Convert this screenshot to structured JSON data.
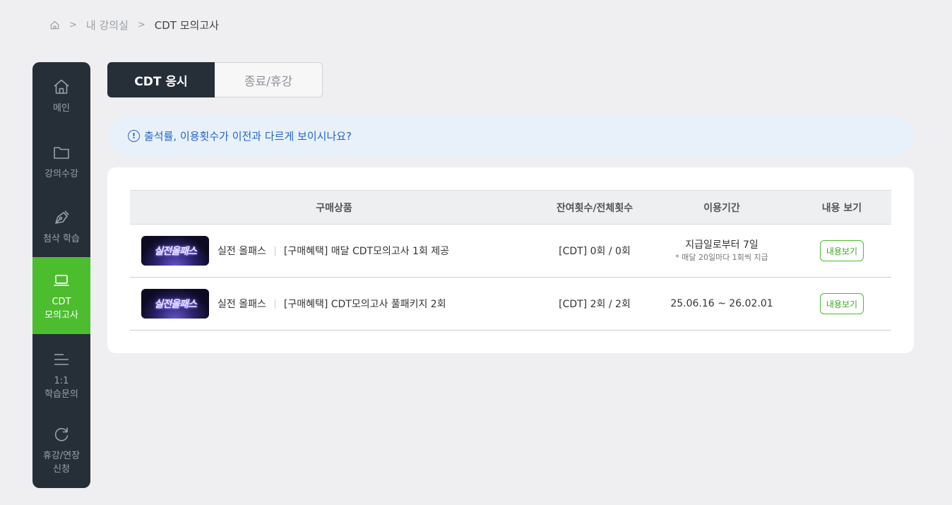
{
  "breadcrumb": {
    "home_icon": "home-icon",
    "items": [
      "내 강의실",
      "CDT 모의고사"
    ]
  },
  "sidebar": {
    "items": [
      {
        "label": "메인",
        "icon": "home-icon"
      },
      {
        "label": "강의수강",
        "icon": "folder-icon"
      },
      {
        "label": "첨삭 학습",
        "icon": "pen-nib-icon"
      },
      {
        "label": "CDT\n모의고사",
        "icon": "laptop-icon",
        "active": true
      },
      {
        "label": "1:1\n학습문의",
        "icon": "menu-lines-icon"
      },
      {
        "label": "휴강/연장\n신청",
        "icon": "refresh-icon"
      }
    ]
  },
  "tabs": {
    "active": "CDT 응시",
    "inactive": "종료/휴강"
  },
  "notice": {
    "icon_text": "!",
    "text": "출석률, 이용횟수가 이전과 다르게 보이시나요?"
  },
  "table": {
    "headers": [
      "구매상품",
      "잔여횟수/전체횟수",
      "이용기간",
      "내용 보기"
    ],
    "rows": [
      {
        "thumb_text": "실전올패스",
        "product": "실전 올패스",
        "description": "[구매혜택] 매달 CDT모의고사 1회 제공",
        "count": "[CDT] 0회 / 0회",
        "period": "지급일로부터 7일",
        "period_note": "* 매달 20일마다 1회씩 지급",
        "button": "내용보기"
      },
      {
        "thumb_text": "실전올패스",
        "product": "실전 올패스",
        "description": "[구매혜택] CDT모의고사 풀패키지 2회",
        "count": "[CDT] 2회 / 2회",
        "period": "25.06.16 ~ 26.02.01",
        "period_note": "",
        "button": "내용보기"
      }
    ]
  },
  "colors": {
    "sidebar_bg": "#262e38",
    "accent_green": "#4cbd2e",
    "notice_blue": "#2463c9",
    "page_bg": "#efeff1"
  }
}
